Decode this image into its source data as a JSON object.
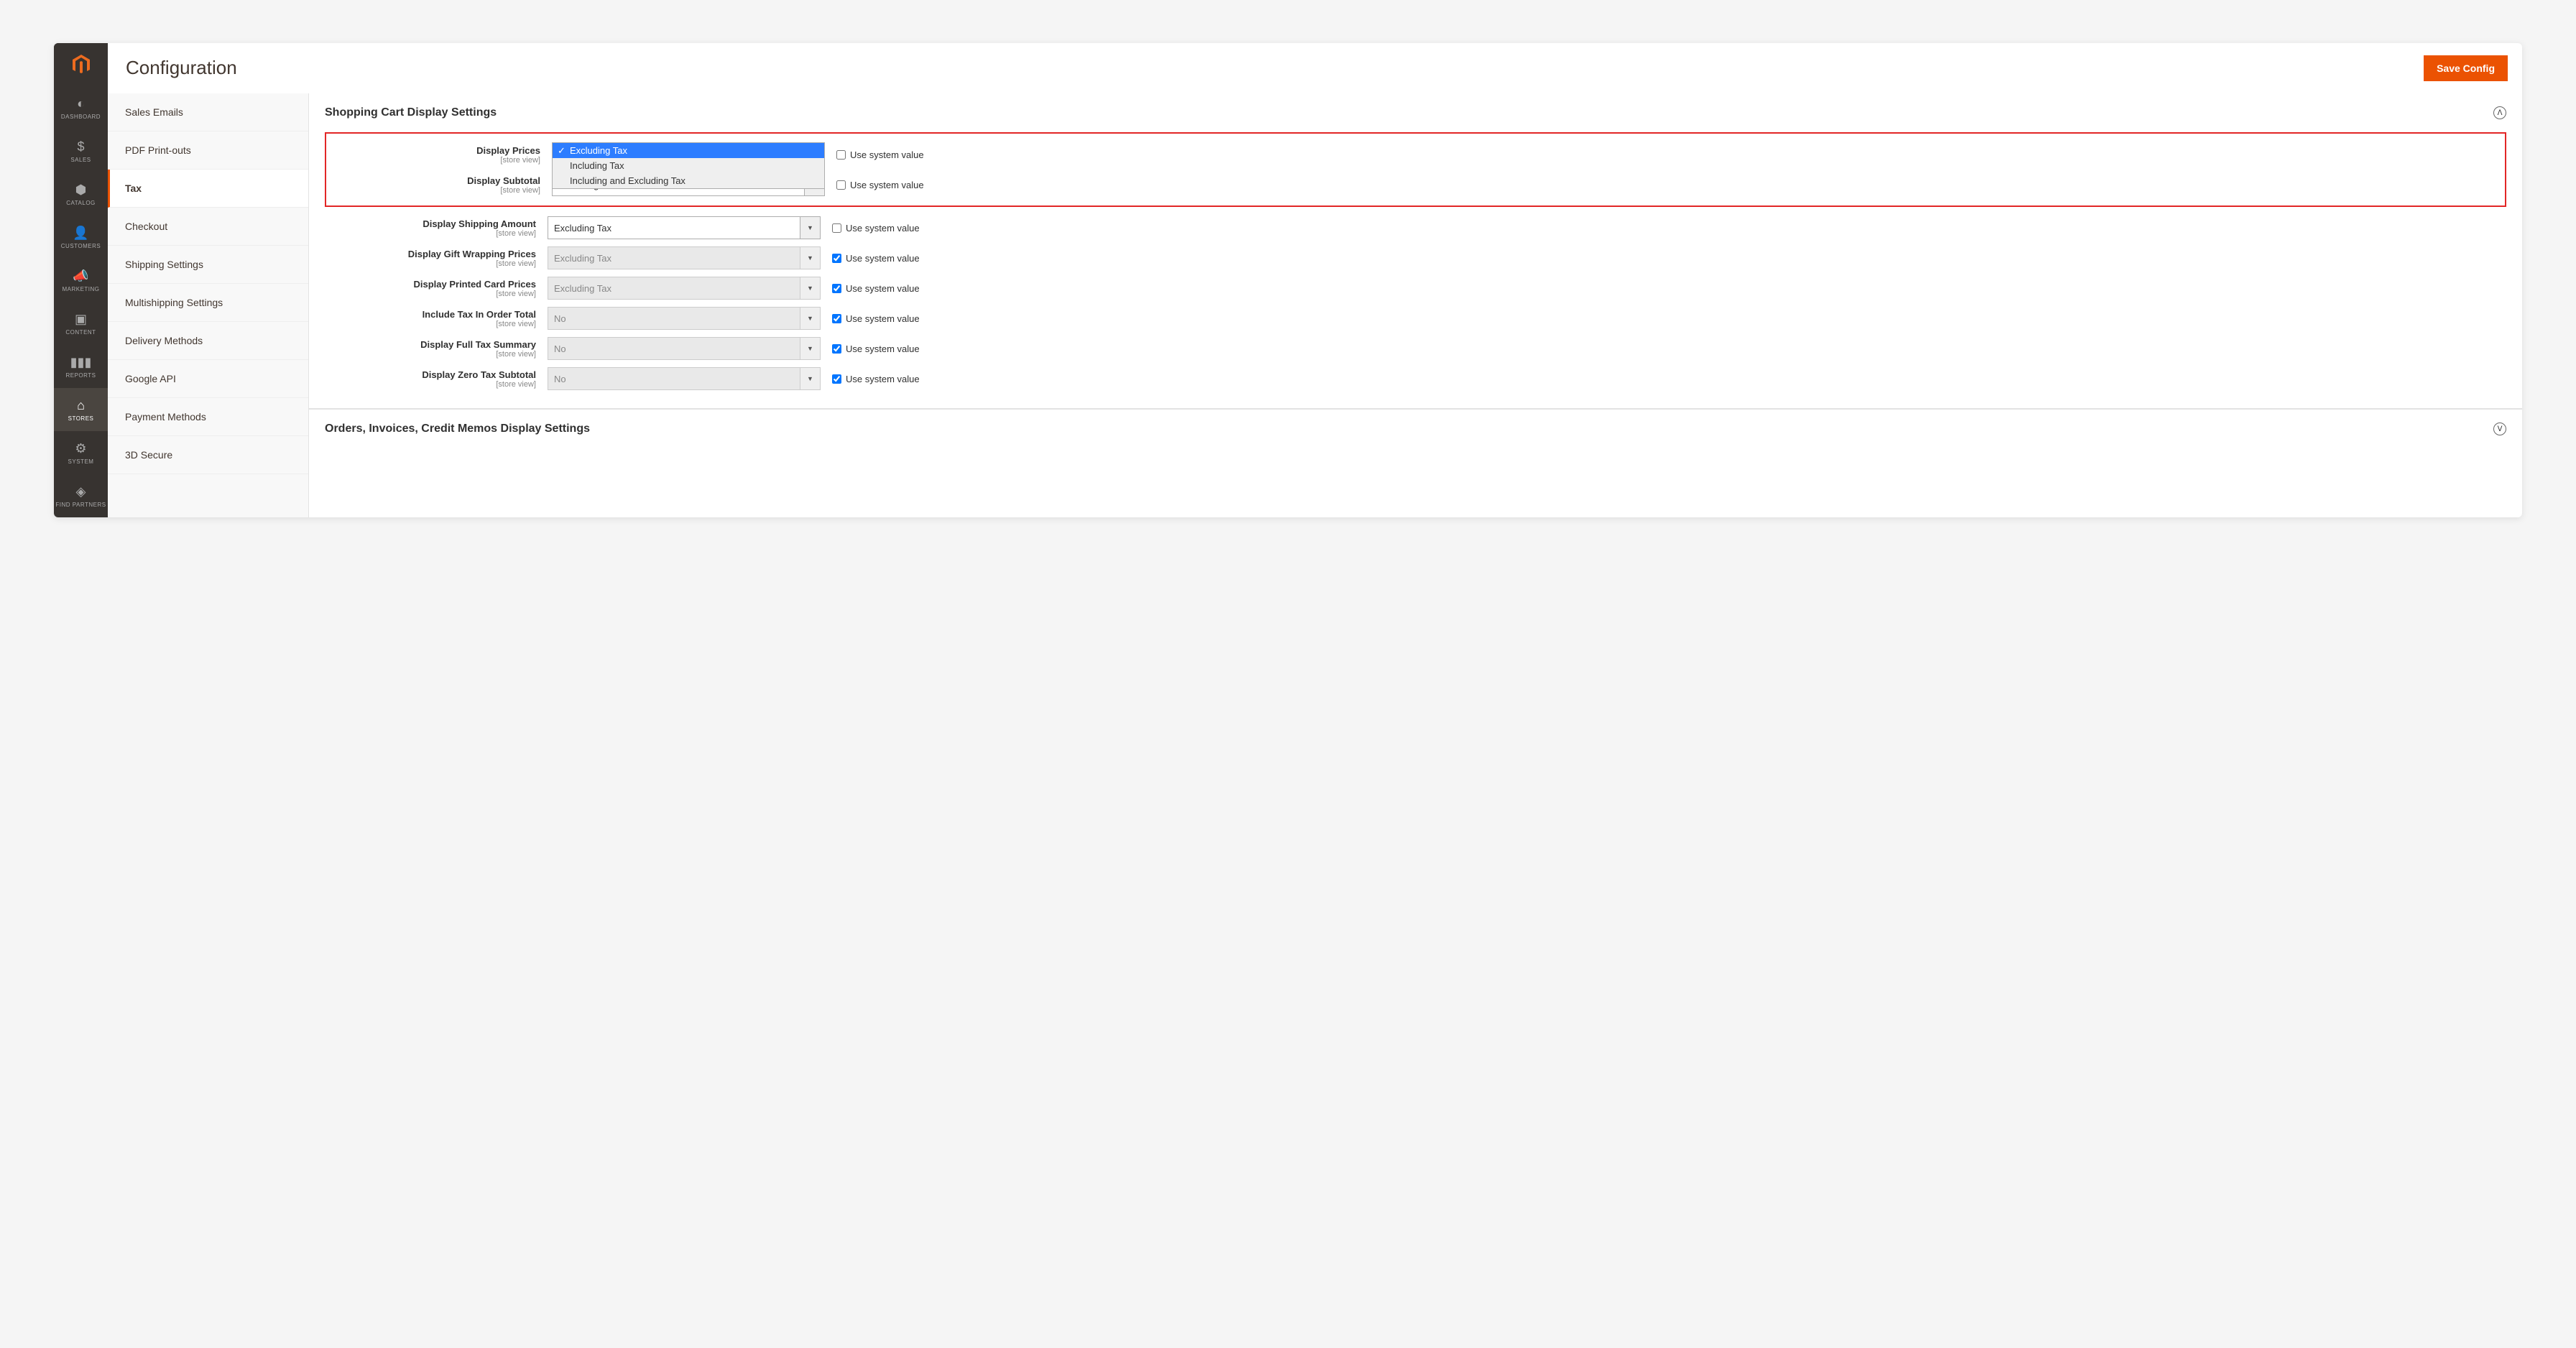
{
  "header": {
    "title": "Configuration",
    "save_button": "Save Config"
  },
  "admin_nav": [
    {
      "id": "dashboard",
      "label": "DASHBOARD",
      "icon": "gauge"
    },
    {
      "id": "sales",
      "label": "SALES",
      "icon": "dollar"
    },
    {
      "id": "catalog",
      "label": "CATALOG",
      "icon": "box"
    },
    {
      "id": "customers",
      "label": "CUSTOMERS",
      "icon": "person"
    },
    {
      "id": "marketing",
      "label": "MARKETING",
      "icon": "megaphone"
    },
    {
      "id": "content",
      "label": "CONTENT",
      "icon": "layout"
    },
    {
      "id": "reports",
      "label": "REPORTS",
      "icon": "bars"
    },
    {
      "id": "stores",
      "label": "STORES",
      "icon": "storefront",
      "active": true
    },
    {
      "id": "system",
      "label": "SYSTEM",
      "icon": "gear"
    },
    {
      "id": "partners",
      "label": "FIND PARTNERS",
      "icon": "cube"
    }
  ],
  "subnav": {
    "items": [
      {
        "label": "Sales Emails"
      },
      {
        "label": "PDF Print-outs"
      },
      {
        "label": "Tax",
        "active": true
      },
      {
        "label": "Checkout"
      },
      {
        "label": "Shipping Settings"
      },
      {
        "label": "Multishipping Settings"
      },
      {
        "label": "Delivery Methods"
      },
      {
        "label": "Google API"
      },
      {
        "label": "Payment Methods"
      },
      {
        "label": "3D Secure"
      }
    ]
  },
  "section1": {
    "title": "Shopping Cart Display Settings"
  },
  "section2": {
    "title": "Orders, Invoices, Credit Memos Display Settings"
  },
  "scope_label": "[store view]",
  "use_system_label": "Use system value",
  "dropdown_options": [
    "Excluding Tax",
    "Including Tax",
    "Including and Excluding Tax"
  ],
  "fields": [
    {
      "label": "Display Prices",
      "value": "Excluding Tax",
      "use_system": false,
      "disabled": false,
      "open": true
    },
    {
      "label": "Display Subtotal",
      "value": "Excluding Tax",
      "use_system": false,
      "disabled": false
    },
    {
      "label": "Display Shipping Amount",
      "value": "Excluding Tax",
      "use_system": false,
      "disabled": false
    },
    {
      "label": "Display Gift Wrapping Prices",
      "value": "Excluding Tax",
      "use_system": true,
      "disabled": true
    },
    {
      "label": "Display Printed Card Prices",
      "value": "Excluding Tax",
      "use_system": true,
      "disabled": true
    },
    {
      "label": "Include Tax In Order Total",
      "value": "No",
      "use_system": true,
      "disabled": true
    },
    {
      "label": "Display Full Tax Summary",
      "value": "No",
      "use_system": true,
      "disabled": true
    },
    {
      "label": "Display Zero Tax Subtotal",
      "value": "No",
      "use_system": true,
      "disabled": true
    }
  ]
}
